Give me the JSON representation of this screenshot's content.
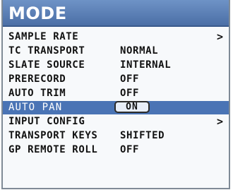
{
  "title": "MODE",
  "menu": {
    "items": [
      {
        "label": "SAMPLE RATE",
        "value": "",
        "has_submenu": true
      },
      {
        "label": "TC TRANSPORT",
        "value": "NORMAL",
        "has_submenu": false
      },
      {
        "label": "SLATE SOURCE",
        "value": "INTERNAL",
        "has_submenu": false
      },
      {
        "label": "PRERECORD",
        "value": "OFF",
        "has_submenu": false
      },
      {
        "label": "AUTO TRIM",
        "value": "OFF",
        "has_submenu": false
      },
      {
        "label": "AUTO PAN",
        "value": "ON",
        "has_submenu": false,
        "selected": true
      },
      {
        "label": "INPUT CONFIG",
        "value": "",
        "has_submenu": true
      },
      {
        "label": "TRANSPORT KEYS",
        "value": "SHIFTED",
        "has_submenu": false
      },
      {
        "label": "GP REMOTE ROLL",
        "value": "OFF",
        "has_submenu": false
      }
    ],
    "chevron_glyph": ">"
  },
  "colors": {
    "title_bar": "#4b6fa6",
    "selected_row": "#4a74b5"
  }
}
